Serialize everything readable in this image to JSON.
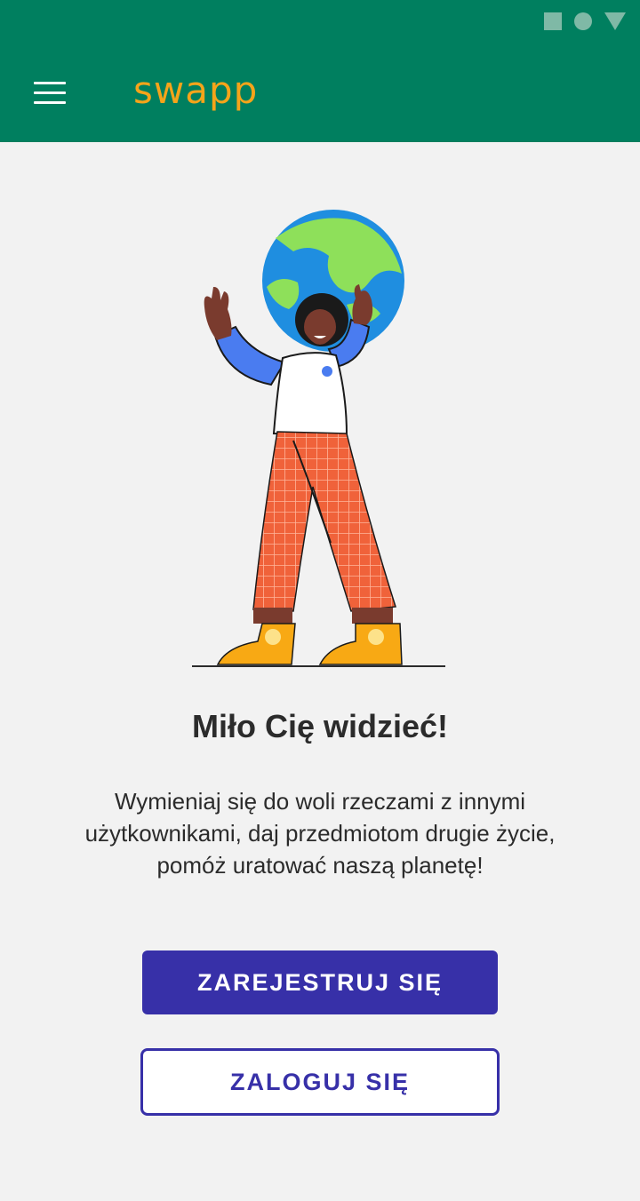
{
  "status_bar": {
    "icons": [
      "square-icon",
      "circle-icon",
      "triangle-icon"
    ],
    "icon_color": "#7fb9a6"
  },
  "app_bar": {
    "background": "#007f5f",
    "menu_icon": "hamburger-menu-icon",
    "logo_text": "swapp",
    "logo_color": "#f5a41a"
  },
  "hero": {
    "illustration": "person-holding-globe-illustration"
  },
  "welcome": {
    "title": "Miło Cię widzieć!",
    "text": "Wymieniaj się do woli rzeczami z innymi użytkownikami, daj przedmiotom drugie życie, pomóż uratować naszą planetę!"
  },
  "actions": {
    "register_label": "ZAREJESTRUJ SIĘ",
    "login_label": "ZALOGUJ SIĘ",
    "accent_color": "#3730a8"
  }
}
